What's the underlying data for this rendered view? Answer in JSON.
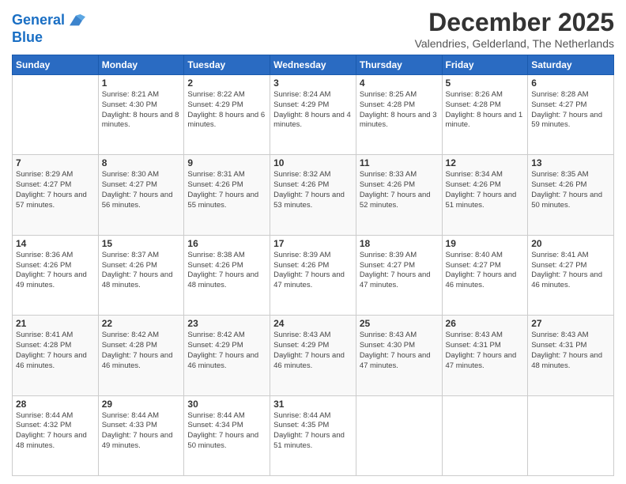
{
  "logo": {
    "line1": "General",
    "line2": "Blue"
  },
  "title": "December 2025",
  "subtitle": "Valendries, Gelderland, The Netherlands",
  "days_of_week": [
    "Sunday",
    "Monday",
    "Tuesday",
    "Wednesday",
    "Thursday",
    "Friday",
    "Saturday"
  ],
  "weeks": [
    [
      {
        "day": "",
        "sunrise": "",
        "sunset": "",
        "daylight": ""
      },
      {
        "day": "1",
        "sunrise": "Sunrise: 8:21 AM",
        "sunset": "Sunset: 4:30 PM",
        "daylight": "Daylight: 8 hours and 8 minutes."
      },
      {
        "day": "2",
        "sunrise": "Sunrise: 8:22 AM",
        "sunset": "Sunset: 4:29 PM",
        "daylight": "Daylight: 8 hours and 6 minutes."
      },
      {
        "day": "3",
        "sunrise": "Sunrise: 8:24 AM",
        "sunset": "Sunset: 4:29 PM",
        "daylight": "Daylight: 8 hours and 4 minutes."
      },
      {
        "day": "4",
        "sunrise": "Sunrise: 8:25 AM",
        "sunset": "Sunset: 4:28 PM",
        "daylight": "Daylight: 8 hours and 3 minutes."
      },
      {
        "day": "5",
        "sunrise": "Sunrise: 8:26 AM",
        "sunset": "Sunset: 4:28 PM",
        "daylight": "Daylight: 8 hours and 1 minute."
      },
      {
        "day": "6",
        "sunrise": "Sunrise: 8:28 AM",
        "sunset": "Sunset: 4:27 PM",
        "daylight": "Daylight: 7 hours and 59 minutes."
      }
    ],
    [
      {
        "day": "7",
        "sunrise": "Sunrise: 8:29 AM",
        "sunset": "Sunset: 4:27 PM",
        "daylight": "Daylight: 7 hours and 57 minutes."
      },
      {
        "day": "8",
        "sunrise": "Sunrise: 8:30 AM",
        "sunset": "Sunset: 4:27 PM",
        "daylight": "Daylight: 7 hours and 56 minutes."
      },
      {
        "day": "9",
        "sunrise": "Sunrise: 8:31 AM",
        "sunset": "Sunset: 4:26 PM",
        "daylight": "Daylight: 7 hours and 55 minutes."
      },
      {
        "day": "10",
        "sunrise": "Sunrise: 8:32 AM",
        "sunset": "Sunset: 4:26 PM",
        "daylight": "Daylight: 7 hours and 53 minutes."
      },
      {
        "day": "11",
        "sunrise": "Sunrise: 8:33 AM",
        "sunset": "Sunset: 4:26 PM",
        "daylight": "Daylight: 7 hours and 52 minutes."
      },
      {
        "day": "12",
        "sunrise": "Sunrise: 8:34 AM",
        "sunset": "Sunset: 4:26 PM",
        "daylight": "Daylight: 7 hours and 51 minutes."
      },
      {
        "day": "13",
        "sunrise": "Sunrise: 8:35 AM",
        "sunset": "Sunset: 4:26 PM",
        "daylight": "Daylight: 7 hours and 50 minutes."
      }
    ],
    [
      {
        "day": "14",
        "sunrise": "Sunrise: 8:36 AM",
        "sunset": "Sunset: 4:26 PM",
        "daylight": "Daylight: 7 hours and 49 minutes."
      },
      {
        "day": "15",
        "sunrise": "Sunrise: 8:37 AM",
        "sunset": "Sunset: 4:26 PM",
        "daylight": "Daylight: 7 hours and 48 minutes."
      },
      {
        "day": "16",
        "sunrise": "Sunrise: 8:38 AM",
        "sunset": "Sunset: 4:26 PM",
        "daylight": "Daylight: 7 hours and 48 minutes."
      },
      {
        "day": "17",
        "sunrise": "Sunrise: 8:39 AM",
        "sunset": "Sunset: 4:26 PM",
        "daylight": "Daylight: 7 hours and 47 minutes."
      },
      {
        "day": "18",
        "sunrise": "Sunrise: 8:39 AM",
        "sunset": "Sunset: 4:27 PM",
        "daylight": "Daylight: 7 hours and 47 minutes."
      },
      {
        "day": "19",
        "sunrise": "Sunrise: 8:40 AM",
        "sunset": "Sunset: 4:27 PM",
        "daylight": "Daylight: 7 hours and 46 minutes."
      },
      {
        "day": "20",
        "sunrise": "Sunrise: 8:41 AM",
        "sunset": "Sunset: 4:27 PM",
        "daylight": "Daylight: 7 hours and 46 minutes."
      }
    ],
    [
      {
        "day": "21",
        "sunrise": "Sunrise: 8:41 AM",
        "sunset": "Sunset: 4:28 PM",
        "daylight": "Daylight: 7 hours and 46 minutes."
      },
      {
        "day": "22",
        "sunrise": "Sunrise: 8:42 AM",
        "sunset": "Sunset: 4:28 PM",
        "daylight": "Daylight: 7 hours and 46 minutes."
      },
      {
        "day": "23",
        "sunrise": "Sunrise: 8:42 AM",
        "sunset": "Sunset: 4:29 PM",
        "daylight": "Daylight: 7 hours and 46 minutes."
      },
      {
        "day": "24",
        "sunrise": "Sunrise: 8:43 AM",
        "sunset": "Sunset: 4:29 PM",
        "daylight": "Daylight: 7 hours and 46 minutes."
      },
      {
        "day": "25",
        "sunrise": "Sunrise: 8:43 AM",
        "sunset": "Sunset: 4:30 PM",
        "daylight": "Daylight: 7 hours and 47 minutes."
      },
      {
        "day": "26",
        "sunrise": "Sunrise: 8:43 AM",
        "sunset": "Sunset: 4:31 PM",
        "daylight": "Daylight: 7 hours and 47 minutes."
      },
      {
        "day": "27",
        "sunrise": "Sunrise: 8:43 AM",
        "sunset": "Sunset: 4:31 PM",
        "daylight": "Daylight: 7 hours and 48 minutes."
      }
    ],
    [
      {
        "day": "28",
        "sunrise": "Sunrise: 8:44 AM",
        "sunset": "Sunset: 4:32 PM",
        "daylight": "Daylight: 7 hours and 48 minutes."
      },
      {
        "day": "29",
        "sunrise": "Sunrise: 8:44 AM",
        "sunset": "Sunset: 4:33 PM",
        "daylight": "Daylight: 7 hours and 49 minutes."
      },
      {
        "day": "30",
        "sunrise": "Sunrise: 8:44 AM",
        "sunset": "Sunset: 4:34 PM",
        "daylight": "Daylight: 7 hours and 50 minutes."
      },
      {
        "day": "31",
        "sunrise": "Sunrise: 8:44 AM",
        "sunset": "Sunset: 4:35 PM",
        "daylight": "Daylight: 7 hours and 51 minutes."
      },
      {
        "day": "",
        "sunrise": "",
        "sunset": "",
        "daylight": ""
      },
      {
        "day": "",
        "sunrise": "",
        "sunset": "",
        "daylight": ""
      },
      {
        "day": "",
        "sunrise": "",
        "sunset": "",
        "daylight": ""
      }
    ]
  ]
}
